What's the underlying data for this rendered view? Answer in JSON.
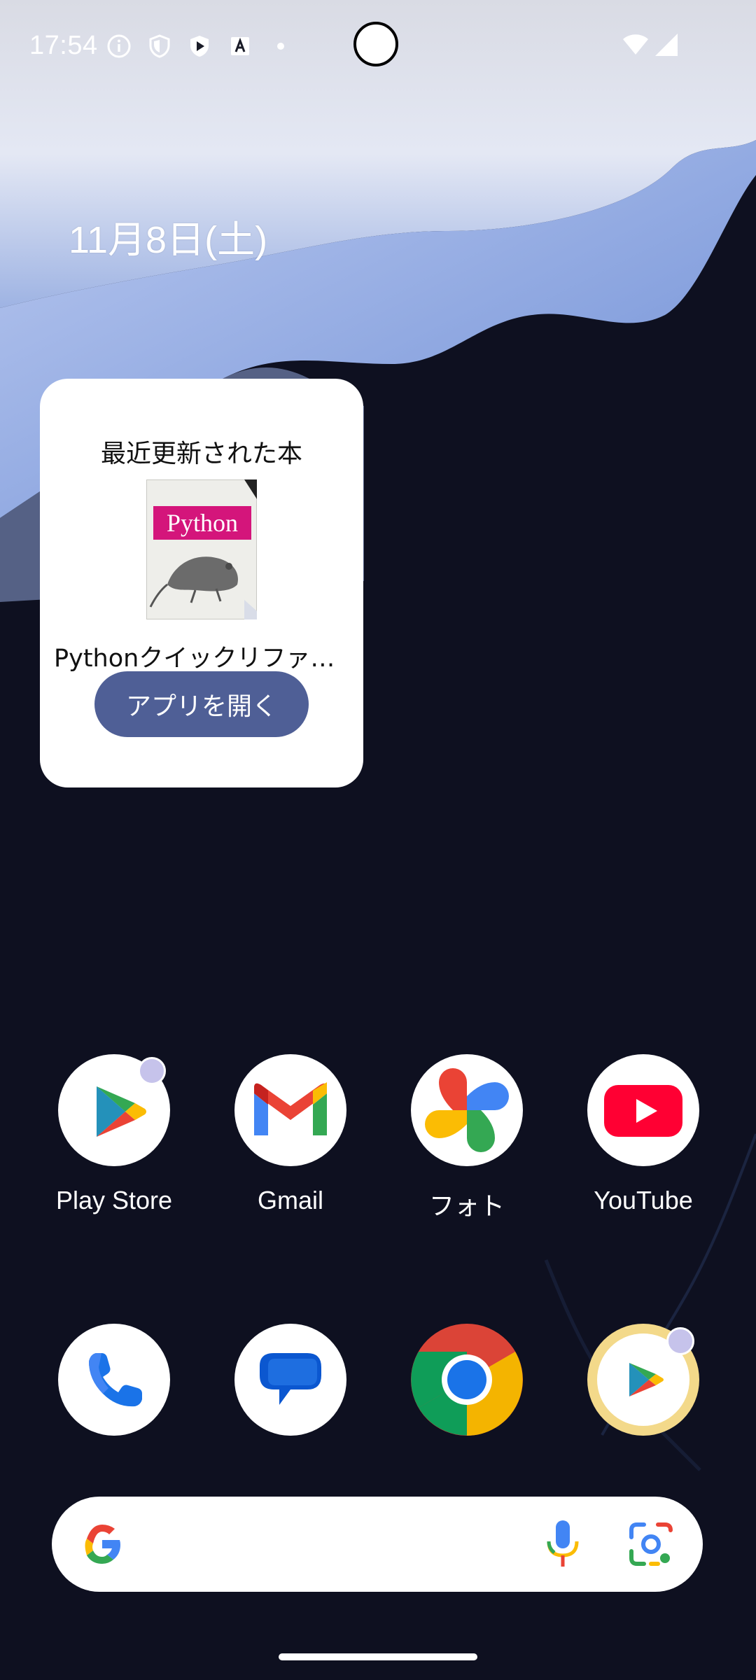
{
  "status_bar": {
    "time": "17:54",
    "icons": [
      "info-icon",
      "shield-icon",
      "play-protect-icon",
      "translate-icon",
      "dot-icon",
      "wifi-icon",
      "cell-signal-icon"
    ]
  },
  "date": "11月8日(土)",
  "widget": {
    "title": "最近更新された本",
    "book_cover_text": "Python",
    "book_title": "Pythonクイックリファ…",
    "open_button": "アプリを開く"
  },
  "apps_row1": [
    {
      "label": "Play Store",
      "icon": "play-store-icon",
      "notification_dot": true
    },
    {
      "label": "Gmail",
      "icon": "gmail-icon",
      "notification_dot": false
    },
    {
      "label": "フォト",
      "icon": "photos-icon",
      "notification_dot": false
    },
    {
      "label": "YouTube",
      "icon": "youtube-icon",
      "notification_dot": false
    }
  ],
  "dock": [
    {
      "icon": "phone-icon"
    },
    {
      "icon": "messages-icon"
    },
    {
      "icon": "chrome-icon"
    },
    {
      "icon": "play-store-icon",
      "notification_dot": true
    }
  ],
  "search_bar": {
    "icons": [
      "google-g-icon",
      "microphone-icon",
      "google-lens-icon"
    ]
  },
  "colors": {
    "button": "#4f5f96",
    "wallpaper_dark": "#0e1020",
    "wallpaper_light": "#dfe5f6"
  }
}
